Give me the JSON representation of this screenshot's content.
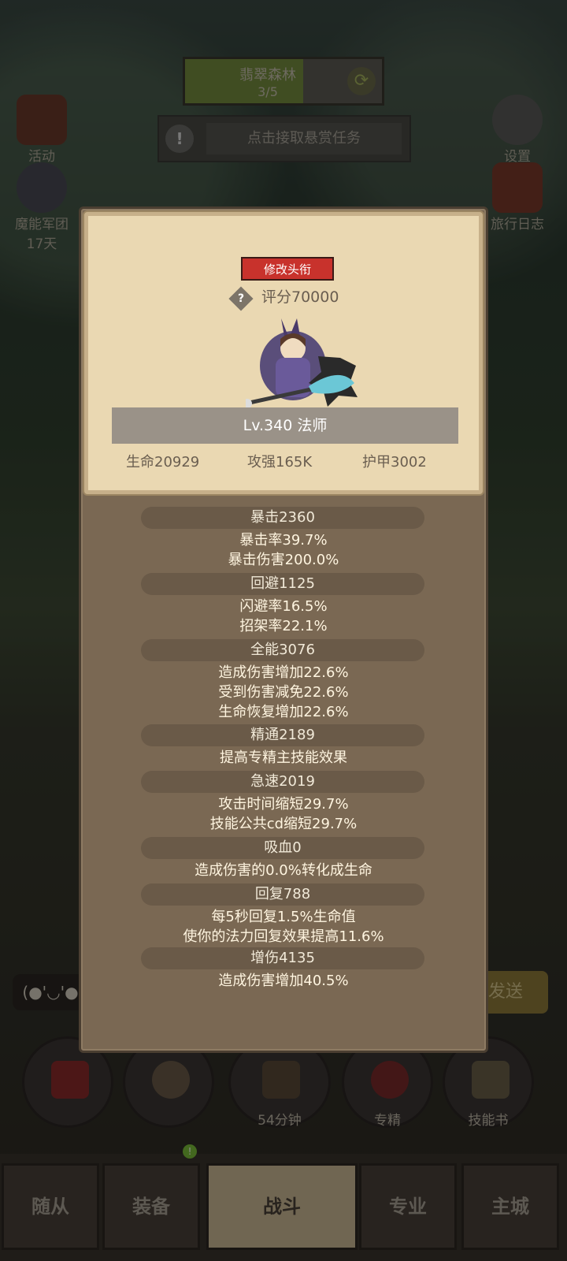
{
  "header": {
    "map_name": "翡翠森林",
    "map_progress": "3/5",
    "quest_text": "点击接取悬赏任务",
    "left_buttons": [
      {
        "label": "活动"
      },
      {
        "label": "魔能军团",
        "sub": "17天"
      }
    ],
    "right_buttons": [
      {
        "label": "设置"
      },
      {
        "label": "旅行日志"
      }
    ]
  },
  "bottom": {
    "emote": "(●'◡'●",
    "send": "发送",
    "circles": [
      {
        "label": ""
      },
      {
        "label": ""
      },
      {
        "label": "54分钟"
      },
      {
        "label": "专精"
      },
      {
        "label": "技能书"
      }
    ],
    "nav": [
      {
        "label": "随从"
      },
      {
        "label": "装备"
      },
      {
        "label": "战斗"
      },
      {
        "label": "专业"
      },
      {
        "label": "主城"
      }
    ]
  },
  "profile": {
    "edit_title_button": "修改头衔",
    "help_icon": "?",
    "score": "评分70000",
    "level_class": "Lv.340 法师",
    "hp": "生命20929",
    "attack": "攻强165K",
    "armor": "护甲3002"
  },
  "attributes": [
    {
      "header": "暴击2360",
      "lines": [
        "暴击率39.7%",
        "暴击伤害200.0%"
      ]
    },
    {
      "header": "回避1125",
      "lines": [
        "闪避率16.5%",
        "招架率22.1%"
      ]
    },
    {
      "header": "全能3076",
      "lines": [
        "造成伤害增加22.6%",
        "受到伤害减免22.6%",
        "生命恢复增加22.6%"
      ]
    },
    {
      "header": "精通2189",
      "lines": [
        "提高专精主技能效果"
      ]
    },
    {
      "header": "急速2019",
      "lines": [
        "攻击时间缩短29.7%",
        "技能公共cd缩短29.7%"
      ]
    },
    {
      "header": "吸血0",
      "lines": [
        "造成伤害的0.0%转化成生命"
      ]
    },
    {
      "header": "回复788",
      "lines": [
        "每5秒回复1.5%生命值",
        "使你的法力回复效果提高11.6%"
      ]
    },
    {
      "header": "增伤4135",
      "lines": [
        "造成伤害增加40.5%"
      ]
    }
  ]
}
